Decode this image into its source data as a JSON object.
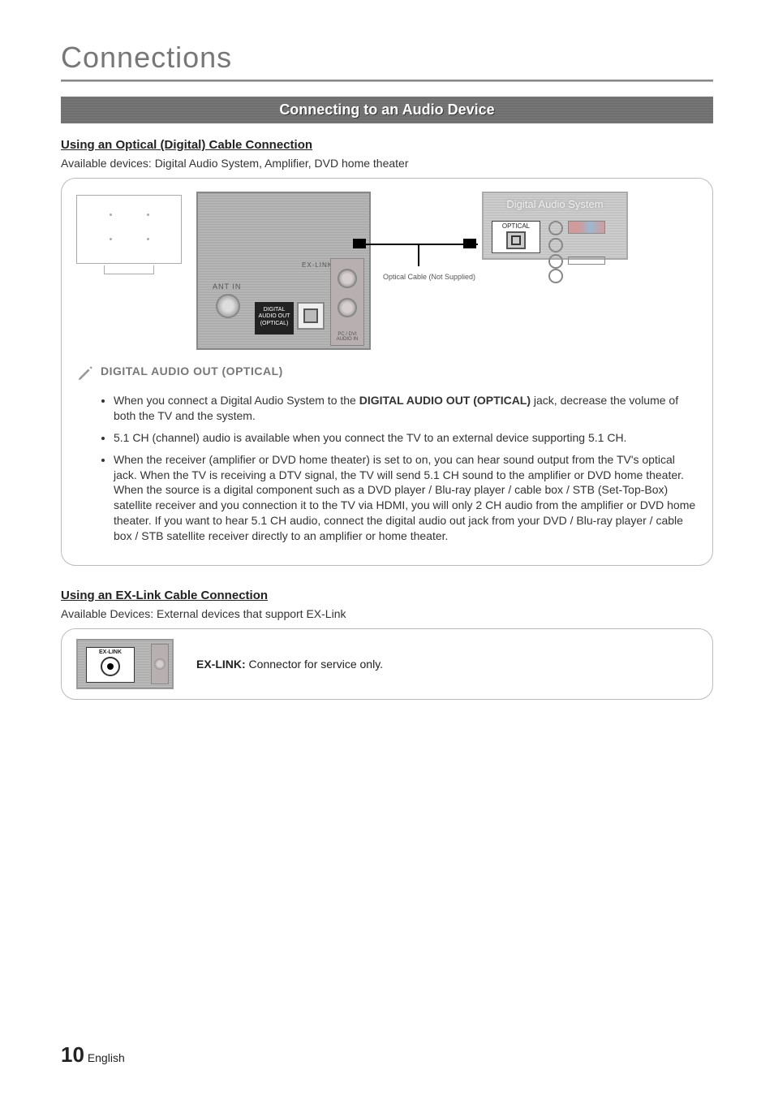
{
  "page": {
    "title": "Connections",
    "banner": "Connecting to an Audio Device",
    "number": "10",
    "lang": "English"
  },
  "section1": {
    "heading": "Using an Optical (Digital) Cable Connection",
    "available": "Available devices: Digital Audio System, Amplifier, DVD home theater",
    "diagram": {
      "back_ant": "ANT IN",
      "back_ex": "EX-LINK",
      "dao_line1": "DIGITAL",
      "dao_line2": "AUDIO OUT",
      "dao_line3": "(OPTICAL)",
      "pc_label": "PC / DVI AUDIO IN",
      "cable_label": "Optical Cable (Not Supplied)",
      "sys_title": "Digital Audio System",
      "sys_optical": "OPTICAL"
    },
    "note_head": "DIGITAL AUDIO OUT (OPTICAL)",
    "bullets": [
      "When you connect a Digital Audio System to the DIGITAL AUDIO OUT (OPTICAL) jack, decrease the volume of both the TV and the system.",
      "5.1 CH (channel) audio is available when you connect the TV to an external device supporting 5.1 CH.",
      "When the receiver (amplifier or DVD home theater) is set to on, you can hear sound output from the TV's optical jack. When the TV is receiving a DTV signal, the TV will send 5.1 CH sound to the amplifier or DVD home theater. When the source is a digital component such as a DVD player / Blu-ray player / cable box / STB (Set-Top-Box) satellite receiver and you connection it to the TV via HDMI, you will only 2 CH audio from the amplifier or DVD home theater. If you want to hear 5.1 CH audio, connect the digital audio out jack from your DVD / Blu-ray player / cable box / STB satellite receiver directly to an amplifier or home theater."
    ],
    "bullet0_bold": "DIGITAL AUDIO OUT (OPTICAL)"
  },
  "section2": {
    "heading": "Using an EX-Link Cable Connection",
    "available": "Available Devices: External devices that support EX-Link",
    "exlabel": "EX-LINK",
    "text_prefix": "EX-LINK:",
    "text_rest": " Connector for service only."
  }
}
